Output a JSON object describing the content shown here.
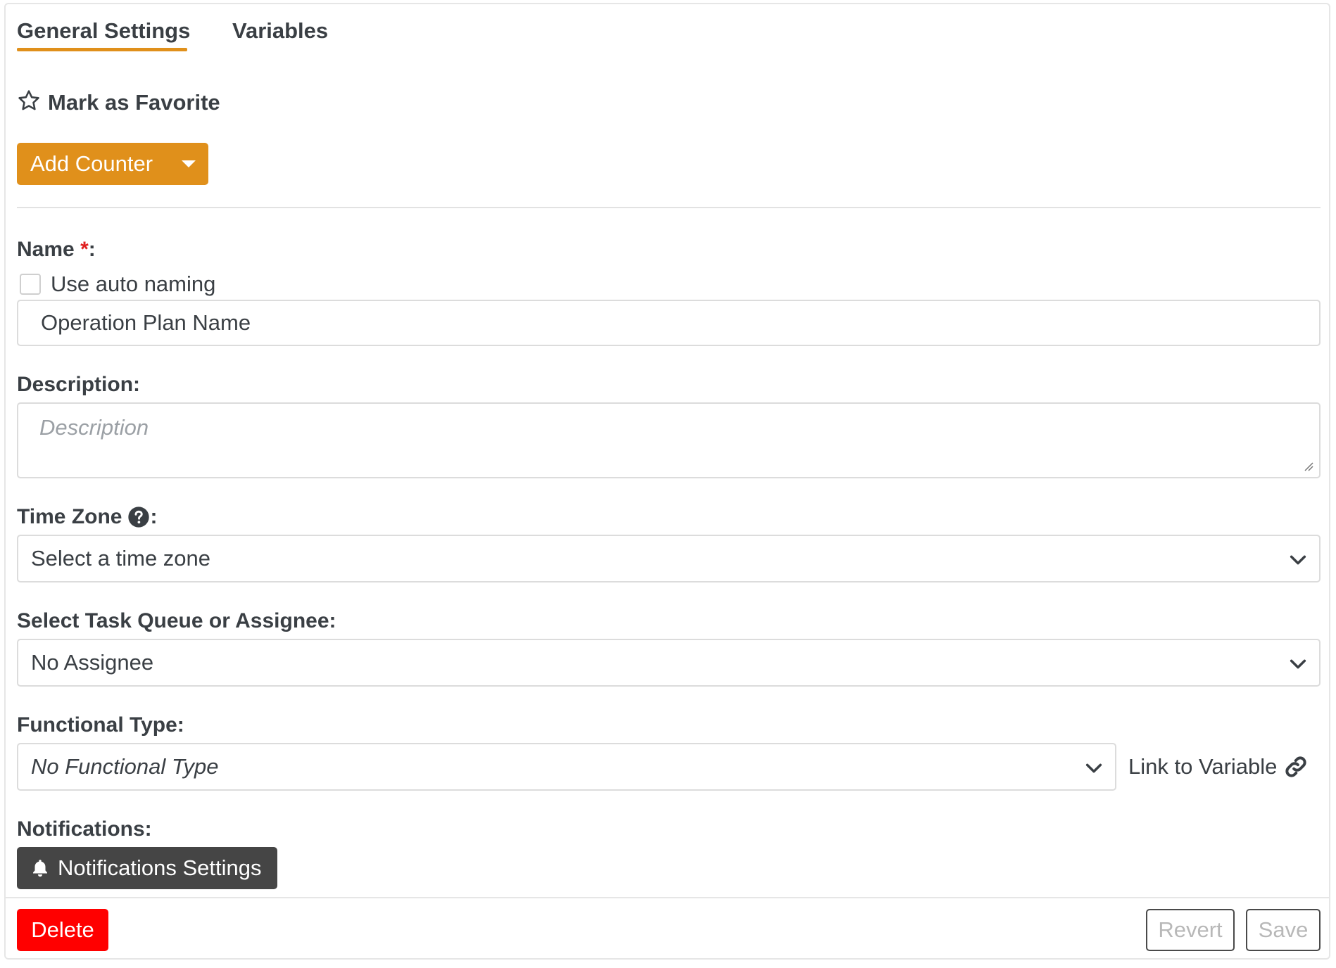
{
  "tabs": [
    {
      "label": "General Settings",
      "active": true
    },
    {
      "label": "Variables",
      "active": false
    }
  ],
  "favorite": {
    "label": "Mark as Favorite",
    "icon": "star-outline-icon"
  },
  "add_counter": {
    "label": "Add Counter",
    "icon": "caret-down-icon"
  },
  "name_field": {
    "label": "Name",
    "required_mark": "*",
    "label_suffix": ":",
    "auto_naming_label": "Use auto naming",
    "auto_naming_checked": false,
    "value": "Operation Plan Name"
  },
  "description_field": {
    "label": "Description:",
    "placeholder": "Description"
  },
  "time_zone_field": {
    "label": "Time Zone",
    "label_suffix": ":",
    "help_icon": "question-circle-icon",
    "value": "Select a time zone"
  },
  "assignee_field": {
    "label": "Select Task Queue or Assignee:",
    "value": "No Assignee"
  },
  "functional_type_field": {
    "label": "Functional Type:",
    "value": "No Functional Type",
    "link_label": "Link to Variable",
    "link_icon": "link-icon"
  },
  "notifications": {
    "label": "Notifications:",
    "button_label": "Notifications Settings",
    "button_icon": "bell-icon"
  },
  "footer": {
    "delete_label": "Delete",
    "revert_label": "Revert",
    "save_label": "Save"
  },
  "colors": {
    "accent": "#e0901b",
    "danger": "#ff0000",
    "dark_button": "#454545",
    "text": "#3a3f44"
  }
}
